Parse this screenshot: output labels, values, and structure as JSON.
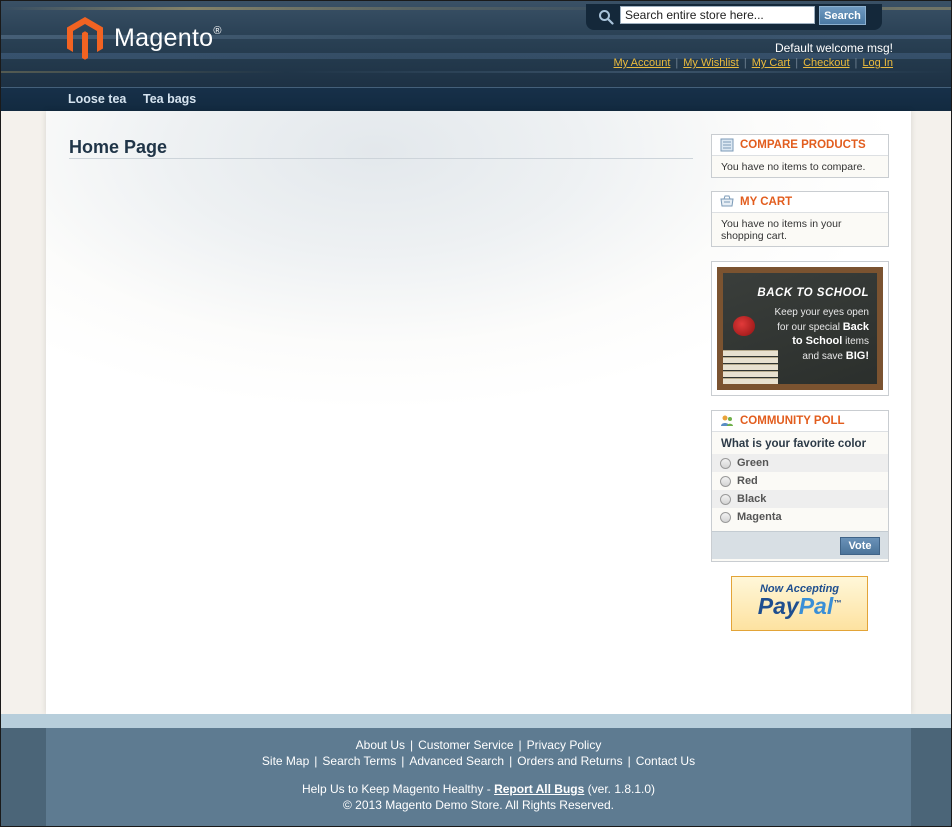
{
  "header": {
    "logo_text": "Magento",
    "logo_reg": "®",
    "search_placeholder": "Search entire store here...",
    "search_button": "Search",
    "welcome": "Default welcome msg!",
    "links": [
      "My Account",
      "My Wishlist",
      "My Cart",
      "Checkout",
      "Log In"
    ]
  },
  "nav": {
    "items": [
      "Loose tea",
      "Tea bags"
    ]
  },
  "main": {
    "page_title": "Home Page"
  },
  "sidebar": {
    "compare": {
      "title": "COMPARE PRODUCTS",
      "text": "You have no items to compare."
    },
    "cart": {
      "title": "MY CART",
      "text": "You have no items in your shopping cart."
    },
    "promo": {
      "headline": "BACK TO SCHOOL",
      "line1": "Keep your eyes open",
      "line2": "for our special",
      "line2_bold": "Back",
      "line3_bold": "to School",
      "line3": "items",
      "line4": "and save",
      "line4_bold": "BIG!"
    },
    "poll": {
      "title": "COMMUNITY POLL",
      "question": "What is your favorite color",
      "options": [
        "Green",
        "Red",
        "Black",
        "Magenta"
      ],
      "vote_button": "Vote"
    },
    "paypal": {
      "top": "Now Accepting",
      "brand_a": "Pay",
      "brand_b": "Pal",
      "tm": "™"
    }
  },
  "footer": {
    "row1": [
      "About Us",
      "Customer Service",
      "Privacy Policy"
    ],
    "row2": [
      "Site Map",
      "Search Terms",
      "Advanced Search",
      "Orders and Returns",
      "Contact Us"
    ],
    "help_prefix": "Help Us to Keep Magento Healthy - ",
    "help_link": "Report All Bugs",
    "help_suffix": " (ver. 1.8.1.0)",
    "copyright": "© 2013 Magento Demo Store. All Rights Reserved."
  },
  "colors": {
    "header_bg": "#2c4357",
    "link_gold": "#ebbb3e",
    "block_title": "#e25d1e",
    "footer_bg": "#5e7b91"
  }
}
